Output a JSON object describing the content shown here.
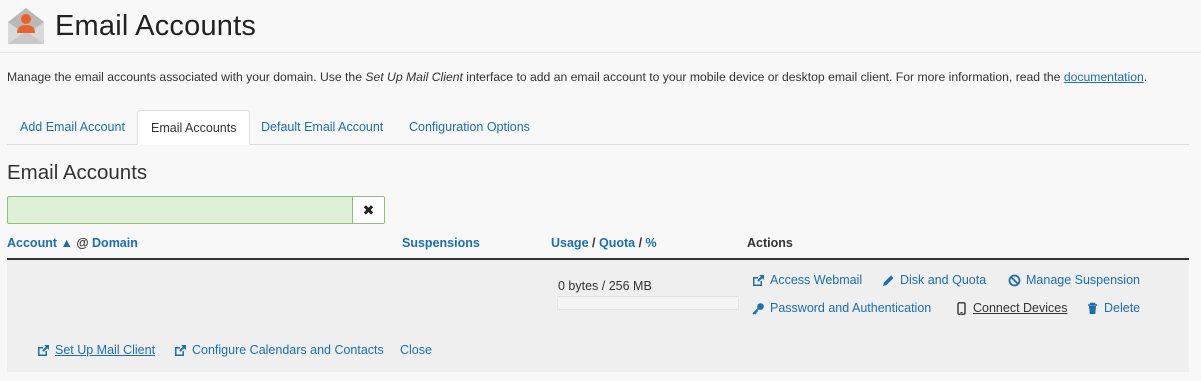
{
  "header": {
    "title": "Email Accounts"
  },
  "description": {
    "prefix": "Manage the email accounts associated with your domain. Use the ",
    "emphasis": "Set Up Mail Client",
    "middle": " interface to add an email account to your mobile device or desktop email client. For more information, read the ",
    "link": "documentation",
    "suffix": "."
  },
  "tabs": [
    {
      "label": "Add Email Account"
    },
    {
      "label": "Email Accounts",
      "active": true
    },
    {
      "label": "Default Email Account"
    },
    {
      "label": "Configuration Options"
    }
  ],
  "section": {
    "title": "Email Accounts"
  },
  "search": {
    "value": "",
    "placeholder": "",
    "clear_icon": "times-icon"
  },
  "table": {
    "headers": {
      "account": "Account",
      "sort_indicator": "▲",
      "at": "@",
      "domain": "Domain",
      "suspensions": "Suspensions",
      "usage": "Usage",
      "sep1": "/",
      "quota": "Quota",
      "sep2": "/",
      "percent": "%",
      "actions": "Actions"
    },
    "row": {
      "usage_text": "0 bytes / 256 MB",
      "usage_fraction": 0,
      "actions": {
        "webmail": "Access Webmail",
        "disk": "Disk and Quota",
        "suspension": "Manage Suspension",
        "password": "Password and Authentication",
        "devices": "Connect Devices",
        "delete": "Delete"
      },
      "footer": {
        "mail_client": "Set Up Mail Client",
        "calendars": "Configure Calendars and Contacts",
        "close": "Close"
      }
    }
  },
  "colors": {
    "link": "#1b6fb1",
    "search_bg": "#dff0d8",
    "row_bg": "#efefef",
    "brand_orange": "#e8632a"
  }
}
